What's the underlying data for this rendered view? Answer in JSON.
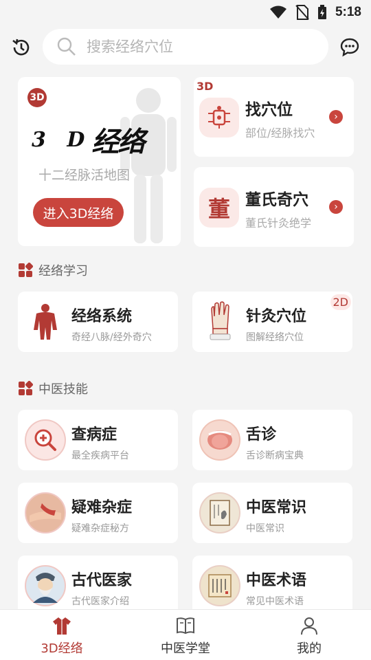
{
  "status_bar": {
    "time": "5:18"
  },
  "search": {
    "placeholder": "搜索经络穴位"
  },
  "hero": {
    "badge": "3D",
    "logo_prefix": "3 D",
    "logo_main": "经络",
    "subtitle": "十二经脉活地图",
    "enter_label": "进入3D经络"
  },
  "side_cards": [
    {
      "badge": "3D",
      "title": "找穴位",
      "subtitle": "部位/经脉找穴"
    },
    {
      "title": "董氏奇穴",
      "subtitle": "董氏针灸绝学",
      "icon_char": "董"
    }
  ],
  "sections": {
    "study": "经络学习",
    "skills": "中医技能"
  },
  "study_cards": [
    {
      "title": "经络系统",
      "subtitle": "奇经八脉/经外奇穴"
    },
    {
      "title": "针灸穴位",
      "subtitle": "图解经络穴位",
      "badge": "2D"
    }
  ],
  "skill_cards": [
    {
      "title": "查病症",
      "subtitle": "最全疾病平台"
    },
    {
      "title": "舌诊",
      "subtitle": "舌诊断病宝典"
    },
    {
      "title": "疑难杂症",
      "subtitle": "疑难杂症秘方"
    },
    {
      "title": "中医常识",
      "subtitle": "中医常识"
    },
    {
      "title": "古代医家",
      "subtitle": "古代医家介绍"
    },
    {
      "title": "中医术语",
      "subtitle": "常见中医术语"
    }
  ],
  "bottom_nav": [
    {
      "label": "3D经络",
      "icon": "robe-icon",
      "active": true
    },
    {
      "label": "中医学堂",
      "icon": "book-icon",
      "active": false
    },
    {
      "label": "我的",
      "icon": "person-icon",
      "active": false
    }
  ],
  "colors": {
    "accent": "#b23a34",
    "button": "#c9453d",
    "background": "#f4f4f4"
  }
}
